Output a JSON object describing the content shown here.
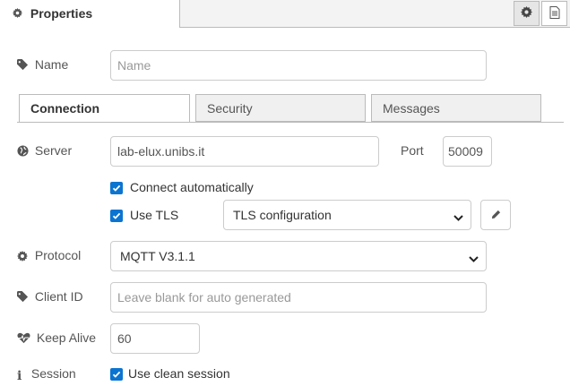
{
  "header": {
    "tab_label": "Properties",
    "tab_icon": "gear-icon",
    "buttons": [
      {
        "name": "settings-button",
        "icon": "gear-icon",
        "active": true
      },
      {
        "name": "description-button",
        "icon": "document-icon",
        "active": false
      }
    ]
  },
  "name_field": {
    "label": "Name",
    "icon": "tag-icon",
    "value": "",
    "placeholder": "Name"
  },
  "tabs": [
    {
      "label": "Connection",
      "active": true
    },
    {
      "label": "Security",
      "active": false
    },
    {
      "label": "Messages",
      "active": false
    }
  ],
  "server": {
    "label": "Server",
    "icon": "globe-icon",
    "value": "lab-elux.unibs.it"
  },
  "port": {
    "label": "Port",
    "value": "50009"
  },
  "connect_auto": {
    "label": "Connect automatically",
    "checked": true
  },
  "use_tls": {
    "label": "Use TLS",
    "checked": true,
    "selected": "TLS configuration"
  },
  "protocol": {
    "label": "Protocol",
    "icon": "gear-icon",
    "selected": "MQTT V3.1.1"
  },
  "client_id": {
    "label": "Client ID",
    "icon": "tag-icon",
    "value": "",
    "placeholder": "Leave blank for auto generated"
  },
  "keep_alive": {
    "label": "Keep Alive",
    "icon": "heartbeat-icon",
    "value": "60"
  },
  "session": {
    "label": "Session",
    "icon": "info-icon",
    "checkbox_label": "Use clean session",
    "checked": true
  },
  "colors": {
    "accent": "#0b74d1",
    "border": "#cccccc",
    "tab_bg": "#f0f0f0"
  }
}
